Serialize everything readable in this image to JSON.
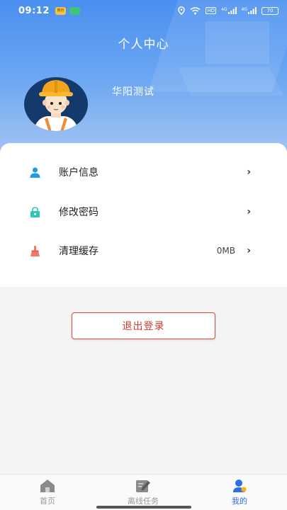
{
  "status": {
    "time": "09:12",
    "badge1": "黄粉",
    "network_label": "HD",
    "signal1": "4G",
    "signal2": "4G",
    "battery": "70"
  },
  "header": {
    "title": "个人中心",
    "user_name": "华阳测试"
  },
  "menu": {
    "items": [
      {
        "label": "账户信息",
        "value": "",
        "chevron": "›",
        "icon": "user-icon",
        "color": "#1f9be8"
      },
      {
        "label": "修改密码",
        "value": "",
        "chevron": "›",
        "icon": "lock-icon",
        "color": "#2cc6b4"
      },
      {
        "label": "清理缓存",
        "value": "0MB",
        "chevron": "›",
        "icon": "broom-icon",
        "color": "#ef7a6e"
      }
    ]
  },
  "logout": {
    "label": "退出登录"
  },
  "nav": {
    "items": [
      {
        "label": "首页",
        "icon": "home-icon"
      },
      {
        "label": "离线任务",
        "icon": "edit-icon"
      },
      {
        "label": "我的",
        "icon": "profile-icon"
      }
    ]
  },
  "colors": {
    "accent": "#2f6fe0",
    "danger": "#d03b30"
  }
}
